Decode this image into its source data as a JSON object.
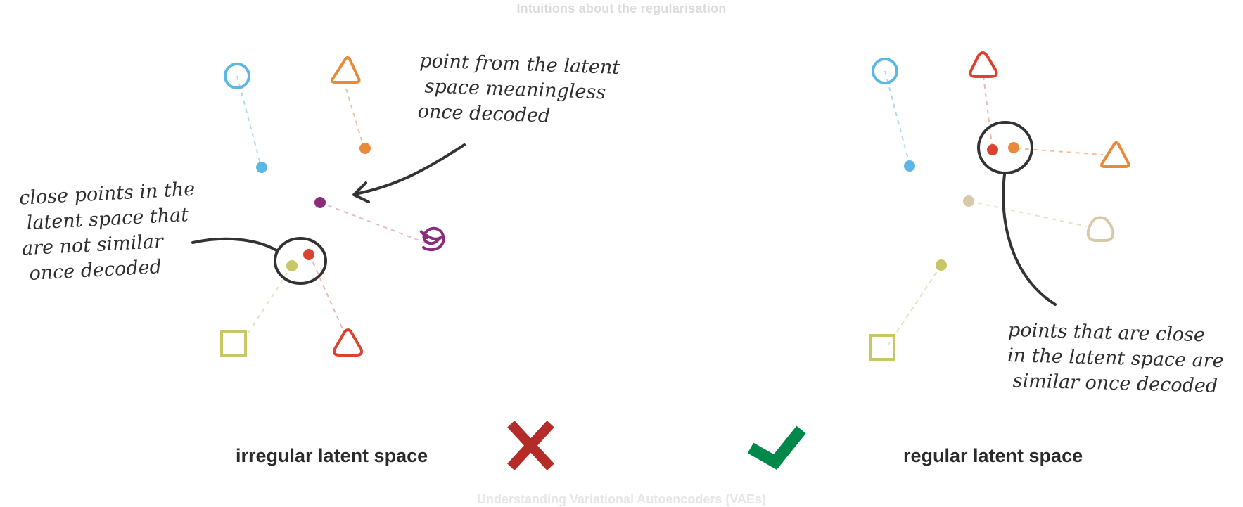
{
  "header_faint": "Intuitions about the regularisation",
  "annotations": {
    "meaningless_point": "point from the latent\n space meaningless\nonce decoded",
    "close_not_similar": "close points in the\n latent space that\nare not similar\n once decoded",
    "close_similar": "points that are close\nin the latent space are\n similar once decoded"
  },
  "labels": {
    "irregular": "irregular latent space",
    "regular": "regular latent space"
  },
  "marks": {
    "cross_color": "#b52b27",
    "check_color": "#00884a"
  },
  "palette": {
    "blue": "#5db7e6",
    "orange": "#e98a3a",
    "purple": "#8a2b7c",
    "red": "#d9432f",
    "yellow_green": "#c6c765",
    "beige": "#d8c9a8",
    "ink": "#333333"
  },
  "footer_faint": "Understanding Variational Autoencoders (VAEs)"
}
